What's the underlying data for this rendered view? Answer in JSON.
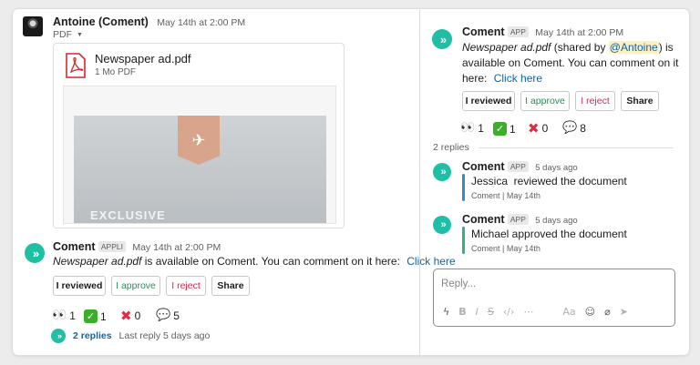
{
  "left": {
    "post": {
      "author": "Antoine (Coment)",
      "time": "May 14th at 2:00 PM",
      "file_type": "PDF",
      "file": {
        "name": "Newspaper ad.pdf",
        "size": "1 Mo PDF",
        "preview_text": "EXCLUSIVE"
      }
    },
    "app_message": {
      "author": "Coment",
      "badge": "APPLI",
      "time": "May 14th at 2:00 PM",
      "doc_name": "Newspaper ad.pdf",
      "text": "is available on Coment. You can comment on it here:",
      "link": "Click here",
      "buttons": [
        "I reviewed",
        "I approve",
        "I reject",
        "Share"
      ],
      "reactions": {
        "eyes": "1",
        "check": "1",
        "cross": "0",
        "speech": "5"
      },
      "replies_link": "2 replies",
      "last_reply": "Last reply 5 days ago"
    }
  },
  "right": {
    "message": {
      "author": "Coment",
      "badge": "APP",
      "time": "May 14th at 2:00 PM",
      "doc_name": "Newspaper ad.pdf",
      "shared_prefix": "(shared by",
      "mention": "@Antoine",
      "shared_suffix": ") is",
      "line2": "available on Coment. You can comment on it",
      "line3": "here:",
      "link": "Click here",
      "buttons": [
        "I reviewed",
        "I approve",
        "I reject",
        "Share"
      ],
      "reactions": {
        "eyes": "1",
        "check": "1",
        "cross": "0",
        "speech": "8"
      }
    },
    "replies_count": "2 replies",
    "replies": [
      {
        "author": "Coment",
        "badge": "APP",
        "time": "5 days ago",
        "text": "Jessica  reviewed the document",
        "meta_source": "Coment",
        "meta_date": "May 14th"
      },
      {
        "author": "Coment",
        "badge": "APP",
        "time": "5 days ago",
        "text": "Michael approved the document",
        "meta_source": "Coment",
        "meta_date": "May 14th"
      }
    ],
    "reply_placeholder": "Reply..."
  },
  "colors": {
    "coment": "#1fbfa6",
    "link": "#1264a3",
    "approve": "#2e8b57",
    "reject": "#d3294a",
    "thread_blue": "#3b88c3",
    "thread_green": "#2eb67d"
  }
}
